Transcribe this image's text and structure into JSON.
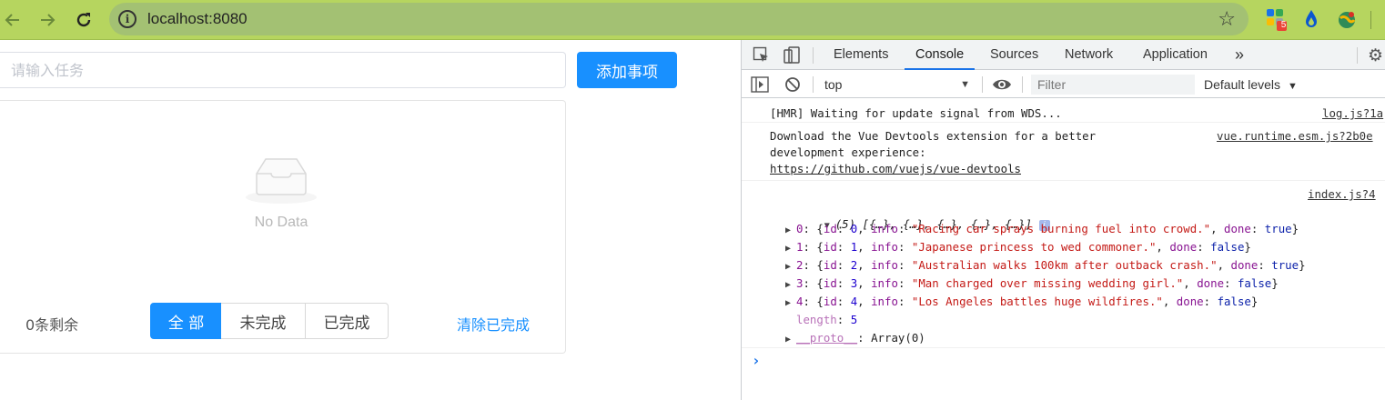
{
  "browser": {
    "url": "localhost:8080",
    "extensions_badge": "5"
  },
  "app": {
    "input_placeholder": "请输入任务",
    "add_button": "添加事项",
    "empty_text": "No Data",
    "remaining": "0条剩余",
    "filters": [
      "全 部",
      "未完成",
      "已完成"
    ],
    "active_filter": "全 部",
    "clear_completed": "清除已完成",
    "accent_color": "#1890ff"
  },
  "devtools": {
    "tabs": [
      "Elements",
      "Console",
      "Sources",
      "Network",
      "Application"
    ],
    "active_tab": "Console",
    "more_tabs": "»",
    "context": "top",
    "filter_placeholder": "Filter",
    "levels": "Default levels",
    "messages": {
      "hmr": {
        "text": "[HMR] Waiting for update signal from WDS...",
        "source": "log.js?1a"
      },
      "vue": {
        "line1": "Download the Vue Devtools extension for a better",
        "line2": "development experience:",
        "link": "https://github.com/vuejs/vue-devtools",
        "source": "vue.runtime.esm.js?2b0e"
      },
      "array": {
        "source": "index.js?4",
        "summary": "(5) [{…}, {…}, {…}, {…}, {…}]",
        "items": [
          {
            "index": "0",
            "id": "0",
            "info": "\"Racing car sprays burning fuel into crowd.\"",
            "done": "true"
          },
          {
            "index": "1",
            "id": "1",
            "info": "\"Japanese princess to wed commoner.\"",
            "done": "false"
          },
          {
            "index": "2",
            "id": "2",
            "info": "\"Australian walks 100km after outback crash.\"",
            "done": "true"
          },
          {
            "index": "3",
            "id": "3",
            "info": "\"Man charged over missing wedding girl.\"",
            "done": "false"
          },
          {
            "index": "4",
            "id": "4",
            "info": "\"Los Angeles battles huge wildfires.\"",
            "done": "false"
          }
        ],
        "length_label": "length",
        "length_value": "5",
        "proto_label": "__proto__",
        "proto_value": "Array(0)"
      }
    },
    "prompt": "›"
  }
}
